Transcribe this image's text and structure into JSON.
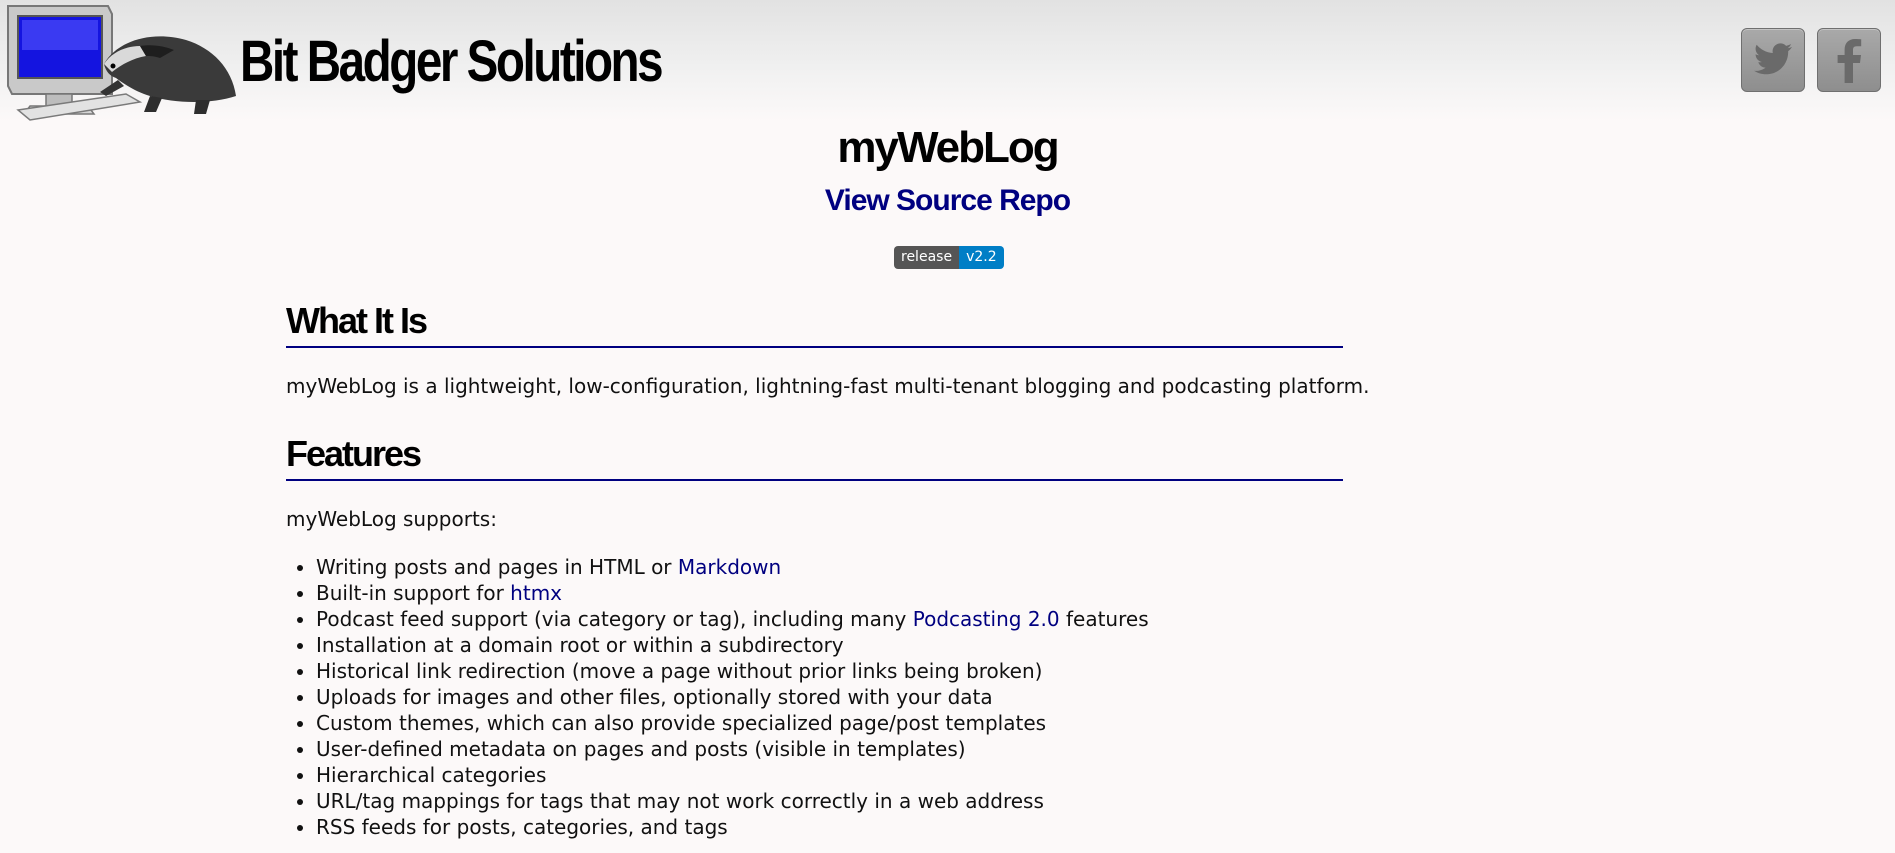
{
  "header": {
    "brand": "Bit Badger Solutions",
    "logo": "computer-and-badger-logo",
    "social": [
      {
        "name": "twitter",
        "icon": "twitter-bird-icon"
      },
      {
        "name": "facebook",
        "icon": "facebook-f-icon"
      }
    ]
  },
  "project": {
    "title": "myWebLog",
    "repo_link": "View Source Repo",
    "badge": {
      "label": "release",
      "value": "v2.2"
    }
  },
  "sections": {
    "what": {
      "heading": "What It Is",
      "text": "myWebLog is a lightweight, low-configuration, lightning-fast multi-tenant blogging and podcasting platform."
    },
    "features": {
      "heading": "Features",
      "intro": "myWebLog supports:",
      "items": {
        "f0": {
          "before": "Writing posts and pages in HTML or ",
          "link": "Markdown",
          "after": ""
        },
        "f1": {
          "before": "Built-in support for ",
          "link": "htmx",
          "after": ""
        },
        "f2": {
          "before": "Podcast feed support (via category or tag), including many ",
          "link": "Podcasting 2.0",
          "after": " features"
        },
        "f3": "Installation at a domain root or within a subdirectory",
        "f4": "Historical link redirection (move a page without prior links being broken)",
        "f5": "Uploads for images and other files, optionally stored with your data",
        "f6": "Custom themes, which can also provide specialized page/post templates",
        "f7": "User-defined metadata on pages and posts (visible in templates)",
        "f8": "Hierarchical categories",
        "f9": "URL/tag mappings for tags that may not work correctly in a web address",
        "f10": "RSS feeds for posts, categories, and tags"
      }
    }
  },
  "colors": {
    "link": "#000080",
    "heading_rule": "#000080",
    "badge_label_bg": "#555555",
    "badge_value_bg": "#007ec6"
  }
}
